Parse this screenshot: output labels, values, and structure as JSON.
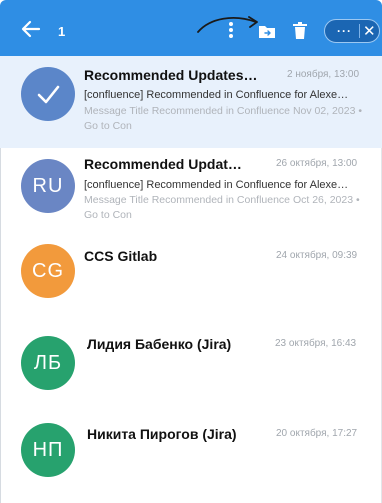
{
  "toolbar": {
    "selected_count": "1",
    "icons": [
      "back-arrow-icon",
      "kebab-menu-icon",
      "move-to-folder-icon",
      "trash-icon",
      "more-icon",
      "close-icon"
    ],
    "more_label": "···",
    "close_label": "✕"
  },
  "colors": {
    "toolbar_bg": "#2f8ee4",
    "selected_row_bg": "#e8f1fc"
  },
  "messages": [
    {
      "avatar_text": "",
      "avatar_icon": "checkmark-icon",
      "avatar_color": "#5b86c9",
      "sender": "Recommended Updates…",
      "date": "2 ноября, 13:00",
      "subject": "[confluence] Recommended in Confluence for Alexe…",
      "preview": "Message Title Recommended in Confluence Nov 02, 2023 • Go to Con",
      "selected": true
    },
    {
      "avatar_text": "RU",
      "avatar_color": "#6a86c4",
      "sender": "Recommended Updat…",
      "date": "26 октября, 13:00",
      "subject": "[confluence] Recommended in Confluence for Alexe…",
      "preview": "Message Title Recommended in Confluence Oct 26, 2023 • Go to Con",
      "selected": false
    },
    {
      "avatar_text": "CG",
      "avatar_color": "#f29a3c",
      "sender": "CCS Gitlab",
      "date": "24 октября, 09:39",
      "subject": "",
      "preview": "",
      "selected": false
    },
    {
      "avatar_text": "ЛБ",
      "avatar_color": "#27a26e",
      "sender": "Лидия Бабенко (Jira)",
      "date": "23 октября, 16:43",
      "subject": "",
      "preview": "",
      "selected": false
    },
    {
      "avatar_text": "НП",
      "avatar_color": "#27a26e",
      "sender": "Никита Пирогов (Jira)",
      "date": "20 октября, 17:27",
      "subject": "",
      "preview": "",
      "selected": false
    }
  ]
}
